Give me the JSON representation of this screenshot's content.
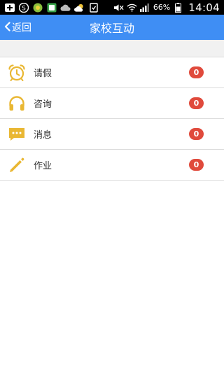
{
  "status_bar": {
    "battery_percent": "66%",
    "time": "14:04"
  },
  "nav": {
    "back_label": "返回",
    "title": "家校互动"
  },
  "colors": {
    "nav_bg": "#3f8ef4",
    "icon_accent": "#e9b733",
    "badge": "#e04a3c"
  },
  "menu": {
    "items": [
      {
        "label": "请假",
        "icon": "alarm-clock-icon",
        "count": "0"
      },
      {
        "label": "咨询",
        "icon": "headphones-icon",
        "count": "0"
      },
      {
        "label": "消息",
        "icon": "message-bubble-icon",
        "count": "0"
      },
      {
        "label": "作业",
        "icon": "pencil-icon",
        "count": "0"
      }
    ]
  }
}
